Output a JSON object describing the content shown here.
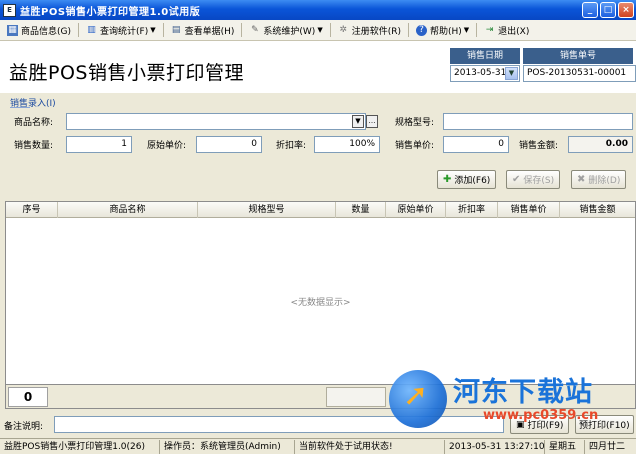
{
  "window": {
    "title": "益胜POS销售小票打印管理1.0试用版"
  },
  "menu": [
    {
      "label": "商品信息(G)",
      "icon": "goods-icon",
      "dropdown": false
    },
    {
      "label": "查询统计(F)",
      "icon": "chart-icon",
      "dropdown": true
    },
    {
      "label": "查看单据(H)",
      "icon": "document-icon",
      "dropdown": false
    },
    {
      "label": "系统维护(W)",
      "icon": "wrench-icon",
      "dropdown": true
    },
    {
      "label": "注册软件(R)",
      "icon": "gear-icon",
      "dropdown": false
    },
    {
      "label": "帮助(H)",
      "icon": "help-icon",
      "dropdown": true
    },
    {
      "label": "退出(X)",
      "icon": "exit-icon",
      "dropdown": false
    }
  ],
  "header": {
    "app_title": "益胜POS销售小票打印管理",
    "date_label": "销售日期",
    "date_value": "2013-05-31",
    "order_label": "销售单号",
    "order_value": "POS-20130531-00001"
  },
  "form": {
    "section_label": "销售录入(I)",
    "product_name_label": "商品名称:",
    "product_name_value": "",
    "spec_label": "规格型号:",
    "spec_value": "",
    "qty_label": "销售数量:",
    "qty_value": "1",
    "orig_price_label": "原始单价:",
    "orig_price_value": "0",
    "discount_label": "折扣率:",
    "discount_value": "100%",
    "sale_price_label": "销售单价:",
    "sale_price_value": "0",
    "amount_label": "销售金额:",
    "amount_value": "0.00",
    "add_button": "添加(F6)",
    "save_button": "保存(S)",
    "delete_button": "删除(D)"
  },
  "grid": {
    "columns": [
      "序号",
      "商品名称",
      "规格型号",
      "数量",
      "原始单价",
      "折扣率",
      "销售单价",
      "销售金额"
    ],
    "empty_text": "<无数据显示>",
    "row_count": "0"
  },
  "remark": {
    "label": "备注说明:",
    "print_button_1": "打印(F9)",
    "print_button_2": "预打印(F10)"
  },
  "status": {
    "app": "益胜POS销售小票打印管理1.0(26)",
    "operator": "操作员：系统管理员(Admin)",
    "trial": "当前软件处于试用状态!",
    "datetime": "2013-05-31 13:27:10",
    "weekday": "星期五",
    "lunar": "四月廿二"
  },
  "watermark": {
    "text": "河东下载站",
    "url": "www.pc0359.cn"
  }
}
